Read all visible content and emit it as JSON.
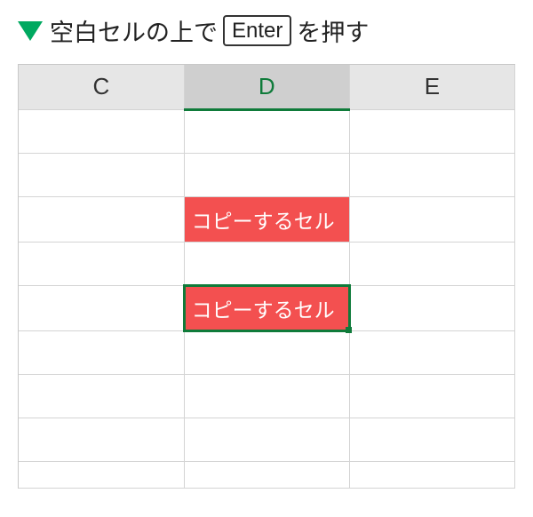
{
  "caption": {
    "before": "空白セルの上で",
    "key": "Enter",
    "after": "を押す"
  },
  "columns": {
    "c": "C",
    "d": "D",
    "e": "E"
  },
  "cells": {
    "copy_cell_1": "コピーするセル",
    "copy_cell_2": "コピーするセル"
  }
}
